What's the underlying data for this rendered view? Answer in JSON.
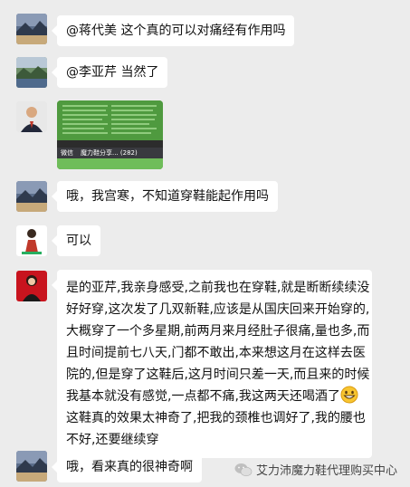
{
  "messages": [
    {
      "avatar": "mountain-lake-avatar",
      "text": "@蒋代美 这个真的可以对痛经有作用吗"
    },
    {
      "avatar": "mountain-lake-avatar",
      "text": "@李亚芹 当然了"
    },
    {
      "avatar": "man-in-suit-avatar",
      "type": "image",
      "image_caption": "魔力鞋分享... (282)",
      "image_back": "微信"
    },
    {
      "avatar": "mountain-lake-avatar",
      "text": "哦，我宫寒，不知道穿鞋能起作用吗"
    },
    {
      "avatar": "woman-figure-avatar",
      "text": "可以"
    },
    {
      "avatar": "woman-red-background-avatar",
      "lines": [
        "是的亚芹,我亲身感受,之前我也在穿鞋,就是断断续续没",
        "好好穿,这次发了几双新鞋,应该是从国庆回来开始穿的,",
        "大概穿了一个多星期,前两月来月经肚子很痛,量也多,而",
        "且时间提前七八天,门都不敢出,本来想这月在这样去医",
        "院的,但是穿了这鞋后,这月时间只差一天,而且来的时候",
        "我基本就没有感觉,一点都不痛,我这两天还喝酒了",
        "这鞋真的效果太神奇了,把我的颈椎也调好了,我的腰也",
        "不好,还要继续穿"
      ]
    },
    {
      "avatar": "mountain-lake-avatar",
      "text": "哦，看来真的很神奇啊"
    }
  ],
  "watermark": {
    "icon": "wechat-icon",
    "text": "艾力沛魔力鞋代理购买中心"
  }
}
